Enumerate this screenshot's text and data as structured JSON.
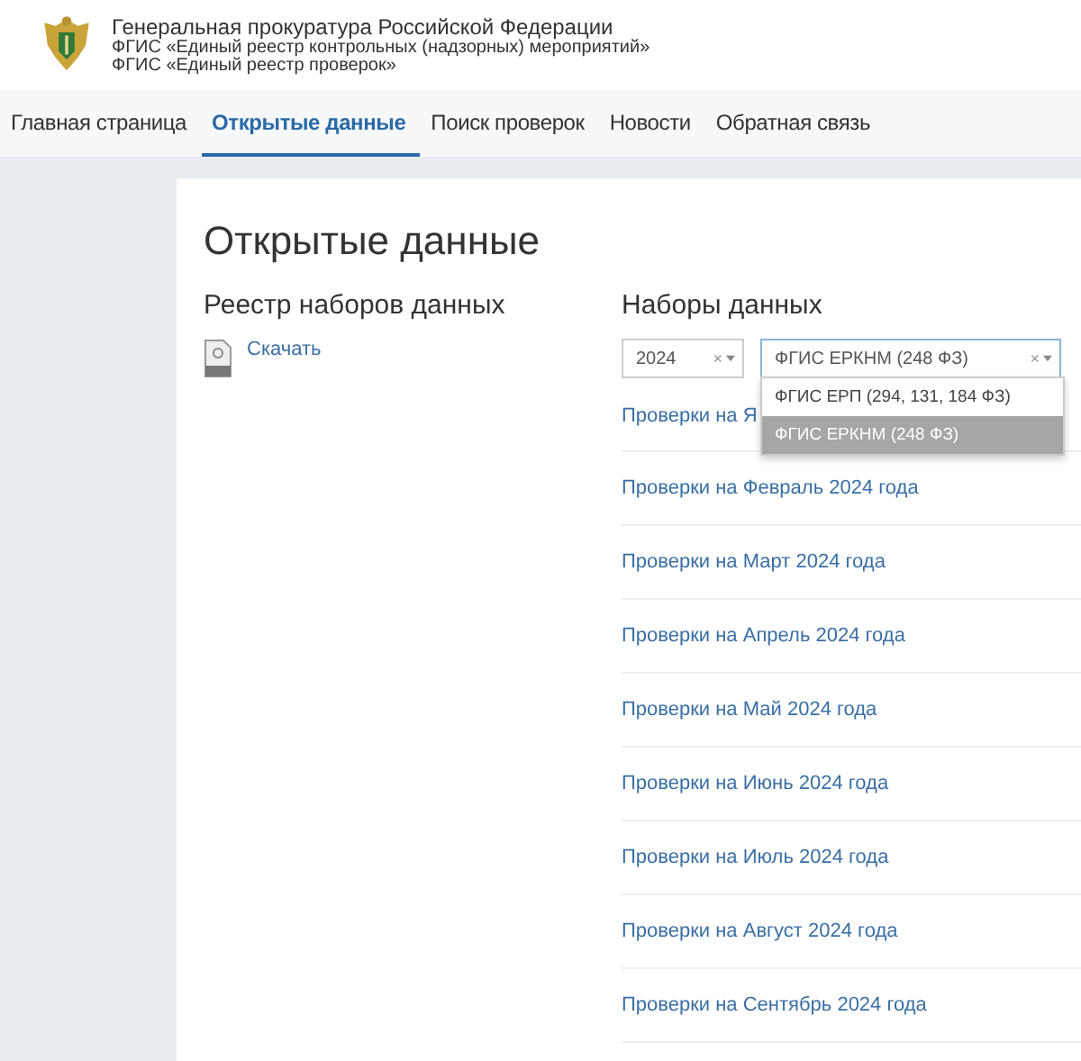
{
  "header": {
    "org": "Генеральная прокуратура Российской Федерации",
    "lines": [
      "ФГИС «Единый реестр контрольных (надзорных) мероприятий»",
      "ФГИС «Единый реестр проверок»"
    ]
  },
  "nav": [
    {
      "label": "Главная страница",
      "selected": false
    },
    {
      "label": "Открытые данные",
      "selected": true
    },
    {
      "label": "Поиск проверок",
      "selected": false
    },
    {
      "label": "Новости",
      "selected": false
    },
    {
      "label": "Обратная связь",
      "selected": false
    }
  ],
  "page_title": "Открытые данные",
  "registry": {
    "title": "Реестр наборов данных",
    "download": "Скачать"
  },
  "datasets": {
    "title": "Наборы данных",
    "year_select": {
      "value": "2024",
      "clear": "×"
    },
    "system_select": {
      "value": "ФГИС ЕРКНМ (248 ФЗ)",
      "clear": "×",
      "expanded": true,
      "options": [
        {
          "label": "ФГИС ЕРП (294, 131, 184 ФЗ)",
          "selected": false
        },
        {
          "label": "ФГИС ЕРКНМ (248 ФЗ)",
          "selected": true
        }
      ]
    },
    "links": [
      "Проверки на Я",
      "Проверки на Февраль 2024 года",
      "Проверки на Март 2024 года",
      "Проверки на Апрель 2024 года",
      "Проверки на Май 2024 года",
      "Проверки на Июнь 2024 года",
      "Проверки на Июль 2024 года",
      "Проверки на Август 2024 года",
      "Проверки на Сентябрь 2024 года"
    ]
  }
}
